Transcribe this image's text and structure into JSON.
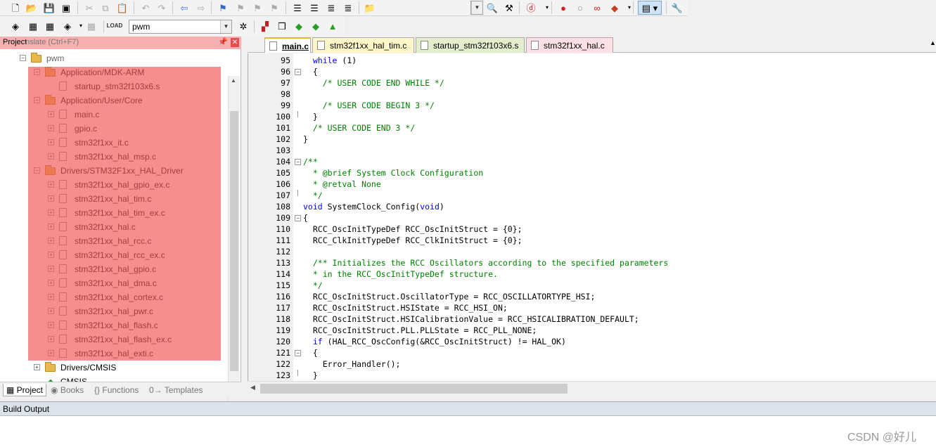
{
  "toolbar_target": {
    "value": "pwm"
  },
  "project_panel": {
    "title": "Project",
    "search_hint": "nslate (Ctrl+F7)",
    "tree": [
      {
        "label": "pwm"
      },
      {
        "label": "Application/MDK-ARM"
      },
      {
        "label": "startup_stm32f103x6.s"
      },
      {
        "label": "Application/User/Core"
      },
      {
        "label": "main.c"
      },
      {
        "label": "gpio.c"
      },
      {
        "label": "stm32f1xx_it.c"
      },
      {
        "label": "stm32f1xx_hal_msp.c"
      },
      {
        "label": "Drivers/STM32F1xx_HAL_Driver"
      },
      {
        "label": "stm32f1xx_hal_gpio_ex.c"
      },
      {
        "label": "stm32f1xx_hal_tim.c"
      },
      {
        "label": "stm32f1xx_hal_tim_ex.c"
      },
      {
        "label": "stm32f1xx_hal.c"
      },
      {
        "label": "stm32f1xx_hal_rcc.c"
      },
      {
        "label": "stm32f1xx_hal_rcc_ex.c"
      },
      {
        "label": "stm32f1xx_hal_gpio.c"
      },
      {
        "label": "stm32f1xx_hal_dma.c"
      },
      {
        "label": "stm32f1xx_hal_cortex.c"
      },
      {
        "label": "stm32f1xx_hal_pwr.c"
      },
      {
        "label": "stm32f1xx_hal_flash.c"
      },
      {
        "label": "stm32f1xx_hal_flash_ex.c"
      },
      {
        "label": "stm32f1xx_hal_exti.c"
      },
      {
        "label": "Drivers/CMSIS"
      },
      {
        "label": "CMSIS"
      }
    ],
    "bottom_tabs": [
      "Project",
      "Books",
      "Functions",
      "Templates"
    ]
  },
  "editor": {
    "tabs": [
      "main.c",
      "stm32f1xx_hal_tim.c",
      "startup_stm32f103x6.s",
      "stm32f1xx_hal.c"
    ],
    "lines": [
      {
        "n": "95",
        "code": "  while (1)"
      },
      {
        "n": "96",
        "code": "  {"
      },
      {
        "n": "97",
        "code": "    /* USER CODE END WHILE */"
      },
      {
        "n": "98",
        "code": ""
      },
      {
        "n": "99",
        "code": "    /* USER CODE BEGIN 3 */"
      },
      {
        "n": "100",
        "code": "  }"
      },
      {
        "n": "101",
        "code": "  /* USER CODE END 3 */"
      },
      {
        "n": "102",
        "code": "}"
      },
      {
        "n": "103",
        "code": ""
      },
      {
        "n": "104",
        "code": "/**"
      },
      {
        "n": "105",
        "code": "  * @brief System Clock Configuration"
      },
      {
        "n": "106",
        "code": "  * @retval None"
      },
      {
        "n": "107",
        "code": "  */"
      },
      {
        "n": "108",
        "code": "void SystemClock_Config(void)"
      },
      {
        "n": "109",
        "code": "{"
      },
      {
        "n": "110",
        "code": "  RCC_OscInitTypeDef RCC_OscInitStruct = {0};"
      },
      {
        "n": "111",
        "code": "  RCC_ClkInitTypeDef RCC_ClkInitStruct = {0};"
      },
      {
        "n": "112",
        "code": ""
      },
      {
        "n": "113",
        "code": "  /** Initializes the RCC Oscillators according to the specified parameters"
      },
      {
        "n": "114",
        "code": "  * in the RCC_OscInitTypeDef structure."
      },
      {
        "n": "115",
        "code": "  */"
      },
      {
        "n": "116",
        "code": "  RCC_OscInitStruct.OscillatorType = RCC_OSCILLATORTYPE_HSI;"
      },
      {
        "n": "117",
        "code": "  RCC_OscInitStruct.HSIState = RCC_HSI_ON;"
      },
      {
        "n": "118",
        "code": "  RCC_OscInitStruct.HSICalibrationValue = RCC_HSICALIBRATION_DEFAULT;"
      },
      {
        "n": "119",
        "code": "  RCC_OscInitStruct.PLL.PLLState = RCC_PLL_NONE;"
      },
      {
        "n": "120",
        "code": "  if (HAL_RCC_OscConfig(&RCC_OscInitStruct) != HAL_OK)"
      },
      {
        "n": "121",
        "code": "  {"
      },
      {
        "n": "122",
        "code": "    Error_Handler();"
      },
      {
        "n": "123",
        "code": "  }"
      }
    ]
  },
  "build_output": {
    "title": "Build Output"
  },
  "watermark": "CSDN @好儿",
  "colors": {
    "highlight_overlay": "#f05a5a",
    "keyword": "#0000ff",
    "comment": "#008000"
  }
}
